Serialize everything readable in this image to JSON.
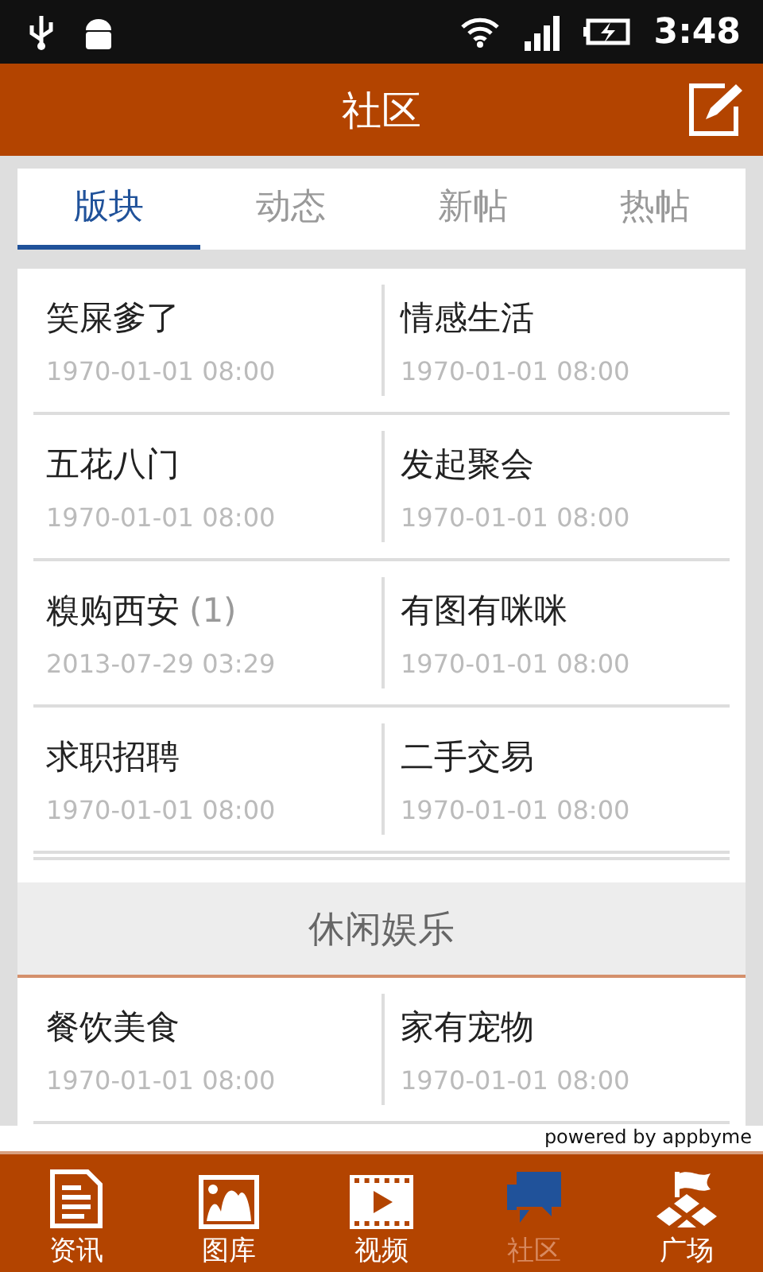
{
  "status_bar": {
    "time": "3:48"
  },
  "header": {
    "title": "社区"
  },
  "tabs": [
    {
      "label": "版块",
      "selected": true
    },
    {
      "label": "动态",
      "selected": false
    },
    {
      "label": "新帖",
      "selected": false
    },
    {
      "label": "热帖",
      "selected": false
    }
  ],
  "sections": [
    {
      "boards": [
        {
          "name": "笑屎爹了",
          "date": "1970-01-01 08:00"
        },
        {
          "name": "情感生活",
          "date": "1970-01-01 08:00"
        },
        {
          "name": "五花八门",
          "date": "1970-01-01 08:00"
        },
        {
          "name": "发起聚会",
          "date": "1970-01-01 08:00"
        },
        {
          "name": "糗购西安",
          "count": "(1)",
          "date": "2013-07-29 03:29"
        },
        {
          "name": "有图有咪咪",
          "date": "1970-01-01 08:00"
        },
        {
          "name": "求职招聘",
          "date": "1970-01-01 08:00"
        },
        {
          "name": "二手交易",
          "date": "1970-01-01 08:00"
        }
      ]
    },
    {
      "title": "休闲娱乐",
      "boards": [
        {
          "name": "餐饮美食",
          "date": "1970-01-01 08:00"
        },
        {
          "name": "家有宠物",
          "date": "1970-01-01 08:00"
        }
      ]
    }
  ],
  "footer_note": "powered by appbyme",
  "bottom_nav": [
    {
      "kind": "document",
      "label": "资讯",
      "selected": false
    },
    {
      "kind": "gallery",
      "label": "图库",
      "selected": false
    },
    {
      "kind": "video",
      "label": "视频",
      "selected": false
    },
    {
      "kind": "chat",
      "label": "社区",
      "selected": true
    },
    {
      "kind": "plaza",
      "label": "广场",
      "selected": false
    }
  ]
}
